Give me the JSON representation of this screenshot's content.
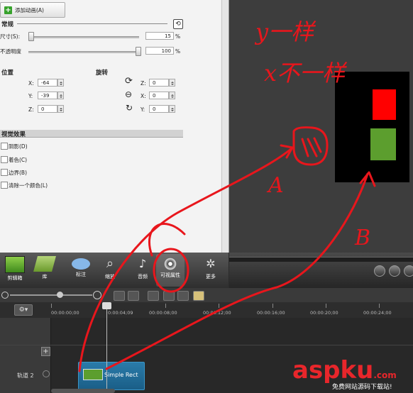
{
  "add_animation_label": "添加动画(A)",
  "general": {
    "title": "常规",
    "size_label": "尺寸(S):",
    "size_value": "15",
    "size_unit": "%",
    "opacity_label": "不透明度",
    "opacity_value": "100",
    "opacity_unit": "%"
  },
  "position": {
    "title": "位置",
    "x_label": "X:",
    "x_value": "-64",
    "y_label": "Y:",
    "y_value": "-39",
    "z_label": "Z:",
    "z_value": "0"
  },
  "rotation": {
    "title": "旋转",
    "z_label": "Z:",
    "z_value": "0",
    "x_label": "X:",
    "x_value": "0",
    "y_label": "Y:",
    "y_value": "0"
  },
  "visual_effects": {
    "title": "视觉效果",
    "items": [
      "阴影(D)",
      "着色(C)",
      "边界(B)",
      "清除一个颜色(L)"
    ]
  },
  "tabs": [
    "剪辑箱",
    "库",
    "标注",
    "缩放",
    "音频",
    "可视属性",
    "更多"
  ],
  "ruler_labels": [
    "00:00:00;00",
    "0:00:04;09",
    "00:00:08;00",
    "00:00:12;00",
    "00:00:16;00",
    "00:00:20;00",
    "00:00:24;00"
  ],
  "track_label": "轨道 2",
  "clip_label": "Simple Rect",
  "annotations": {
    "y_same": "y一样",
    "x_diff": "x不一样",
    "label_a": "A",
    "label_b": "B"
  },
  "watermark": {
    "brand": "aspku",
    "suffix": ".com",
    "tagline": "免费网站源码下载站!"
  },
  "colors": {
    "annotation_red": "#e8161c",
    "red_rect": "#ff0000",
    "green_rect": "#5c9e2e",
    "clip_blue": "#2a7ba9"
  }
}
